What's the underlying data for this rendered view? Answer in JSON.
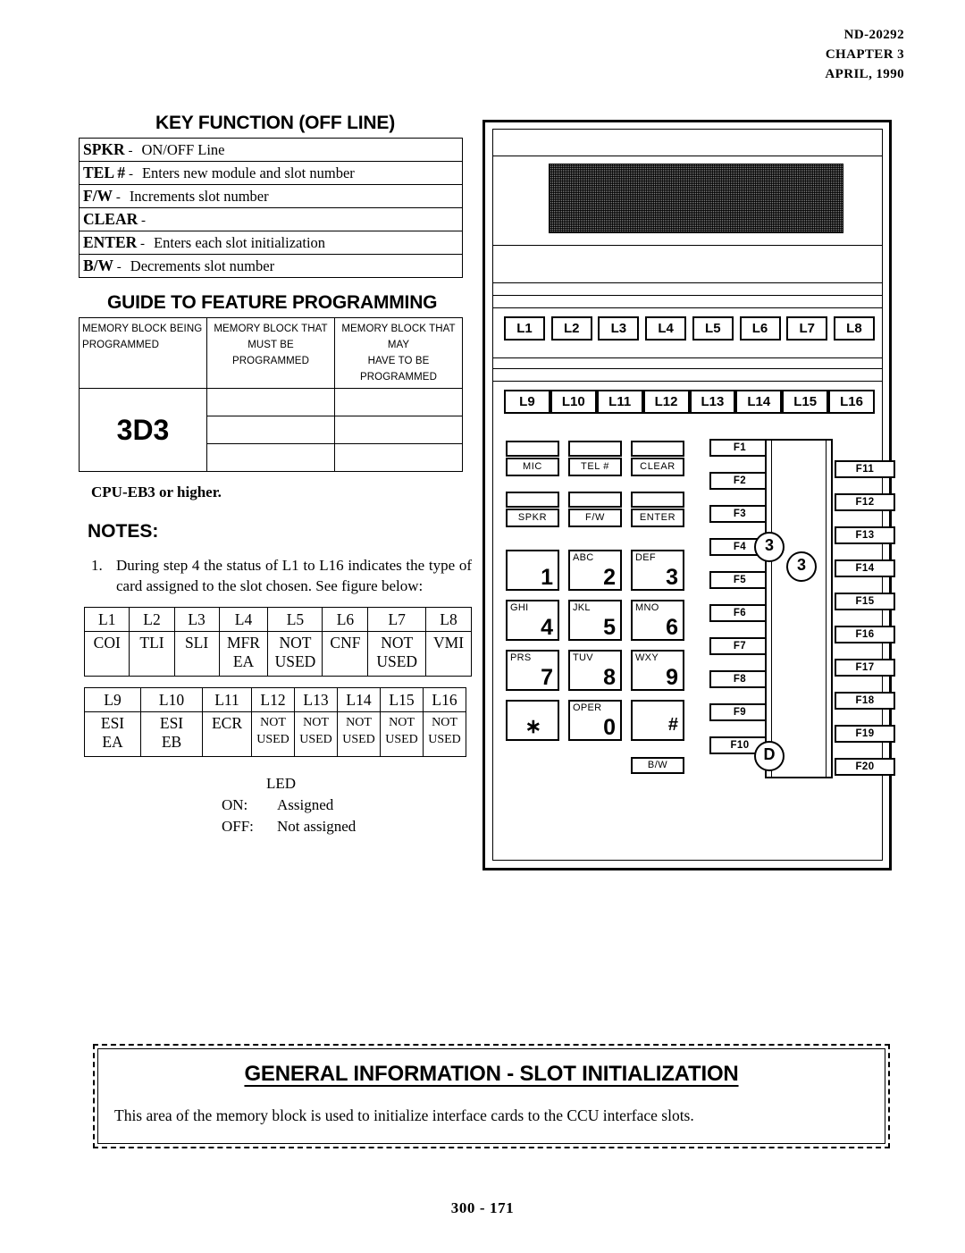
{
  "header": {
    "doc_number": "ND-20292",
    "chapter": "CHAPTER 3",
    "date": "APRIL, 1990"
  },
  "key_function": {
    "title": "KEY FUNCTION (OFF LINE)",
    "rows": [
      {
        "key": "SPKR",
        "dash": "-",
        "desc": "ON/OFF Line"
      },
      {
        "key": "TEL #",
        "dash": "-",
        "desc": "Enters new module and slot number"
      },
      {
        "key": "F/W",
        "dash": "-",
        "desc": "Increments slot number"
      },
      {
        "key": "CLEAR",
        "dash": "-",
        "desc": ""
      },
      {
        "key": "ENTER",
        "dash": "-",
        "desc": "Enters each slot initialization"
      },
      {
        "key": "B/W",
        "dash": "-",
        "desc": "Decrements slot number"
      }
    ]
  },
  "guide": {
    "title": "GUIDE TO FEATURE PROGRAMMING",
    "headers": [
      "MEMORY BLOCK BEING PROGRAMMED",
      "MEMORY BLOCK THAT MUST BE PROGRAMMED",
      "MEMORY BLOCK THAT MAY HAVE TO BE PROGRAMMED"
    ],
    "header_lines": [
      [
        "MEMORY BLOCK BEING",
        "PROGRAMMED"
      ],
      [
        "MEMORY BLOCK THAT",
        "MUST BE PROGRAMMED"
      ],
      [
        "MEMORY BLOCK THAT MAY",
        "HAVE TO BE PROGRAMMED"
      ]
    ],
    "memory_block": "3D3",
    "empty_rows": 3,
    "cpu_note": "CPU-EB3 or higher."
  },
  "notes": {
    "title": "NOTES:",
    "items": [
      {
        "number": "1.",
        "text": "During step 4 the status of L1 to L16 indicates the type of card assigned to the slot chosen.  See figure below:"
      }
    ]
  },
  "card_table_1": {
    "headers": [
      "L1",
      "L2",
      "L3",
      "L4",
      "L5",
      "L6",
      "L7",
      "L8"
    ],
    "values": [
      "COI",
      "TLI",
      "SLI",
      "MFR\nEA",
      "NOT\nUSED",
      "CNF",
      "NOT\nUSED",
      "VMI"
    ]
  },
  "card_table_2": {
    "headers": [
      "L9",
      "L10",
      "L11",
      "L12",
      "L13",
      "L14",
      "L15",
      "L16"
    ],
    "values": [
      "ESI\nEA",
      "ESI\nEB",
      "ECR",
      "NOT\nUSED",
      "NOT\nUSED",
      "NOT\nUSED",
      "NOT\nUSED",
      "NOT\nUSED"
    ]
  },
  "led_legend": {
    "title": "LED",
    "on_label": "ON:",
    "on_value": "Assigned",
    "off_label": "OFF:",
    "off_value": "Not assigned"
  },
  "phone": {
    "line_keys_top": [
      "L1",
      "L2",
      "L3",
      "L4",
      "L5",
      "L6",
      "L7",
      "L8"
    ],
    "line_keys_bottom": [
      "L9",
      "L10",
      "L11",
      "L12",
      "L13",
      "L14",
      "L15",
      "L16"
    ],
    "function_keys": [
      "MIC",
      "TEL #",
      "CLEAR",
      "SPKR",
      "F/W",
      "ENTER"
    ],
    "bw_key": "B/W",
    "dial_keys": [
      {
        "letters": "",
        "digit": "1"
      },
      {
        "letters": "ABC",
        "digit": "2"
      },
      {
        "letters": "DEF",
        "digit": "3"
      },
      {
        "letters": "GHI",
        "digit": "4"
      },
      {
        "letters": "JKL",
        "digit": "5"
      },
      {
        "letters": "MNO",
        "digit": "6"
      },
      {
        "letters": "PRS",
        "digit": "7"
      },
      {
        "letters": "TUV",
        "digit": "8"
      },
      {
        "letters": "WXY",
        "digit": "9"
      },
      {
        "letters": "",
        "digit": "∗"
      },
      {
        "letters": "OPER",
        "digit": "0"
      },
      {
        "letters": "",
        "digit": "#"
      }
    ],
    "f_keys_left": [
      "F1",
      "F2",
      "F3",
      "F4",
      "F5",
      "F6",
      "F7",
      "F8",
      "F9",
      "F10"
    ],
    "f_keys_right": [
      "F11",
      "F12",
      "F13",
      "F14",
      "F15",
      "F16",
      "F17",
      "F18",
      "F19",
      "F20"
    ],
    "markers": [
      "3",
      "3",
      "D"
    ]
  },
  "banner": {
    "title": "GENERAL INFORMATION  -  SLOT INITIALIZATION",
    "text": "This area of the memory block is used to initialize interface cards to the CCU interface slots."
  },
  "page_number": "300 - 171"
}
